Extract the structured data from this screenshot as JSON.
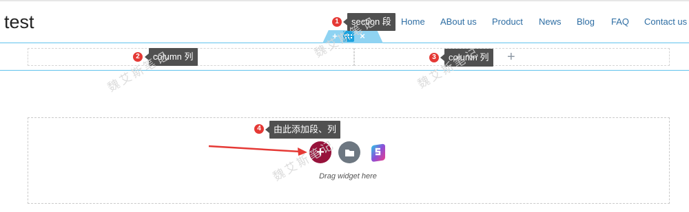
{
  "site": {
    "title": "test"
  },
  "nav": {
    "items": [
      "Home",
      "ABout us",
      "Product",
      "News",
      "Blog",
      "FAQ",
      "Contact us"
    ]
  },
  "section_handle": {
    "add_icon": "plus-icon",
    "drag_icon": "grid-icon",
    "close_icon": "close-icon"
  },
  "callouts": {
    "section": {
      "badge": "1",
      "text": "section 段"
    },
    "column_left": {
      "badge": "2",
      "text": "column 列"
    },
    "column_right": {
      "badge": "3",
      "text": "column 列"
    },
    "add_hint": {
      "badge": "4",
      "text": "由此添加段、列"
    }
  },
  "drop_zone": {
    "drag_text": "Drag widget here"
  },
  "colors": {
    "accent": "#1aa3e0",
    "add_button": "#97123b",
    "template_button": "#6d7781",
    "badge": "#e53935",
    "nav_link": "#2d6da3"
  }
}
